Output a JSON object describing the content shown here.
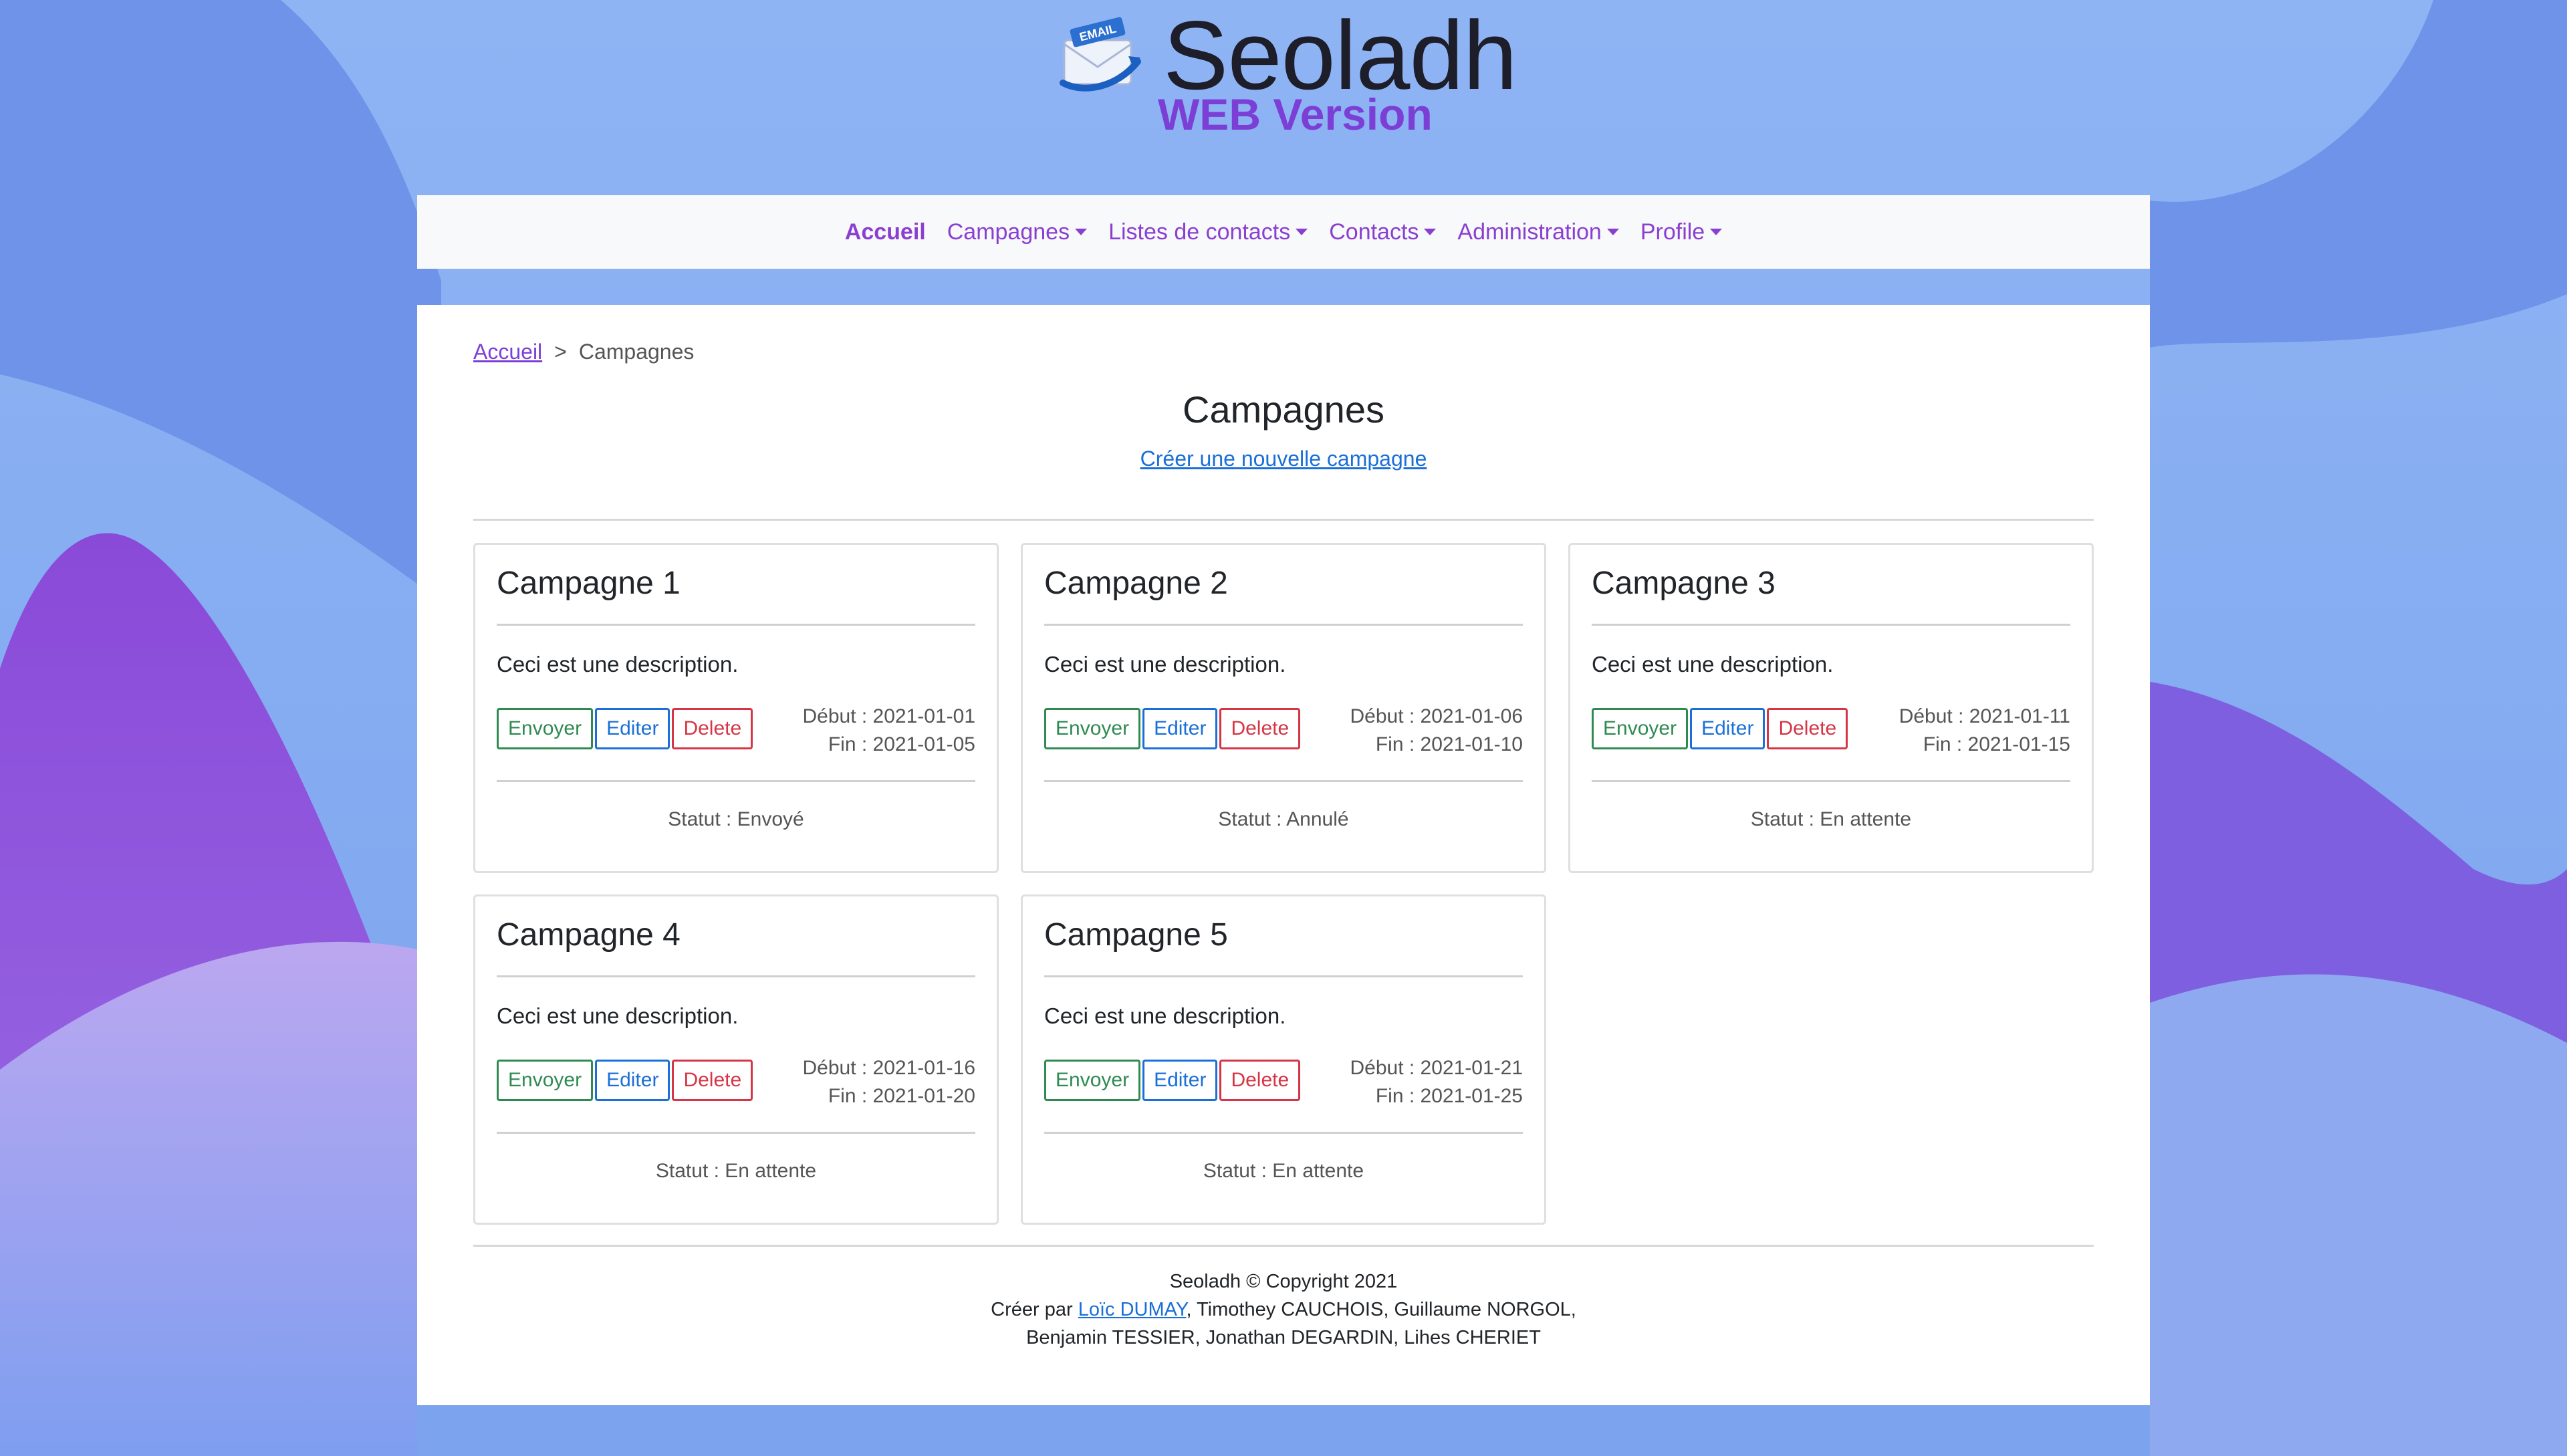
{
  "brand": {
    "title": "Seoladh",
    "subtitle": "WEB Version",
    "icon_badge": "EMAIL",
    "icon": "email-envelope-icon"
  },
  "colors": {
    "accent": "#8a3fd1",
    "link": "#1a6fd8",
    "success": "#2f8a52",
    "danger": "#d63545",
    "bg_blue": "#7fa8f0",
    "bg_purple": "#8a4fe0"
  },
  "nav": {
    "items": [
      {
        "label": "Accueil",
        "dropdown": false,
        "active": true
      },
      {
        "label": "Campagnes",
        "dropdown": true
      },
      {
        "label": "Listes de contacts",
        "dropdown": true
      },
      {
        "label": "Contacts",
        "dropdown": true
      },
      {
        "label": "Administration",
        "dropdown": true
      },
      {
        "label": "Profile",
        "dropdown": true
      }
    ]
  },
  "breadcrumb": {
    "home": "Accueil",
    "separator": ">",
    "current": "Campagnes"
  },
  "page": {
    "title": "Campagnes",
    "create_link": "Créer une nouvelle campagne"
  },
  "campaigns": [
    {
      "title": "Campagne 1",
      "description": "Ceci est une description.",
      "start": "Début : 2021-01-01",
      "end": "Fin : 2021-01-05",
      "status": "Statut : Envoyé"
    },
    {
      "title": "Campagne 2",
      "description": "Ceci est une description.",
      "start": "Début : 2021-01-06",
      "end": "Fin : 2021-01-10",
      "status": "Statut : Annulé"
    },
    {
      "title": "Campagne 3",
      "description": "Ceci est une description.",
      "start": "Début : 2021-01-11",
      "end": "Fin : 2021-01-15",
      "status": "Statut : En attente"
    },
    {
      "title": "Campagne 4",
      "description": "Ceci est une description.",
      "start": "Début : 2021-01-16",
      "end": "Fin : 2021-01-20",
      "status": "Statut : En attente"
    },
    {
      "title": "Campagne 5",
      "description": "Ceci est une description.",
      "start": "Début : 2021-01-21",
      "end": "Fin : 2021-01-25",
      "status": "Statut : En attente"
    }
  ],
  "buttons": {
    "send": "Envoyer",
    "edit": "Editer",
    "delete": "Delete"
  },
  "footer": {
    "copyright": "Seoladh © Copyright 2021",
    "credits_prefix": "Créer par ",
    "credits_link": "Loïc DUMAY",
    "credits_rest": ", Timothey CAUCHOIS, Guillaume NORGOL,",
    "credits_line2": "Benjamin TESSIER, Jonathan DEGARDIN, Lihes CHERIET"
  }
}
